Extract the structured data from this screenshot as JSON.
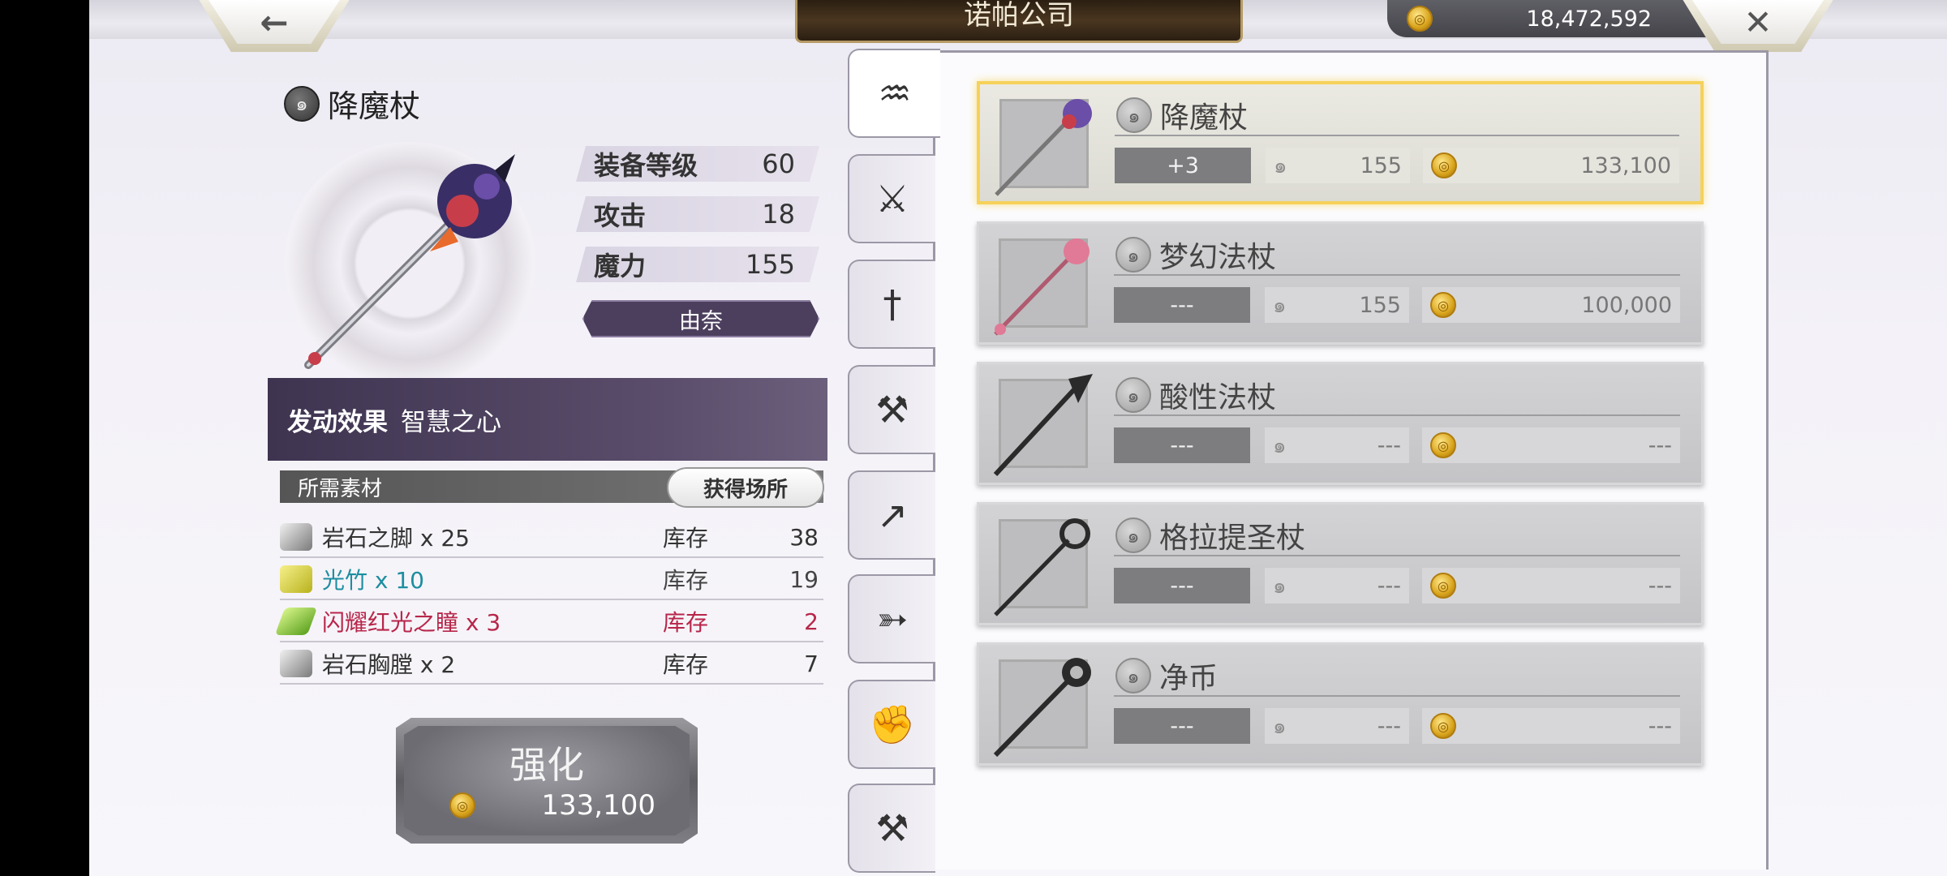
{
  "header": {
    "shop_title": "诺帕公司",
    "gold_amount": "18,472,592",
    "back_icon": "arrow-left",
    "close_icon": "x-close"
  },
  "weapon": {
    "name": "降魔杖",
    "stats": [
      {
        "label": "装备等级",
        "value": "60"
      },
      {
        "label": "攻击",
        "value": "18"
      },
      {
        "label": "魔力",
        "value": "155"
      }
    ],
    "owner": "由奈",
    "effect_label": "发动效果",
    "effect_value": "智慧之心"
  },
  "materials": {
    "header": "所需素材",
    "acquire_button": "获得场所",
    "stock_label": "库存",
    "items": [
      {
        "name": "岩石之脚 x 25",
        "stock": "38",
        "color": "#444444"
      },
      {
        "name": "光竹 x 10",
        "stock": "19",
        "color": "#1d8ea0"
      },
      {
        "name": "闪耀红光之瞳 x 3",
        "stock": "2",
        "color": "#b8264a"
      },
      {
        "name": "岩石胸膛 x 2",
        "stock": "7",
        "color": "#444444"
      }
    ]
  },
  "enhance": {
    "label": "强化",
    "cost": "133,100"
  },
  "tabs": [
    {
      "icon": "rod-icon"
    },
    {
      "icon": "sword-icon"
    },
    {
      "icon": "katana-icon"
    },
    {
      "icon": "axe-icon"
    },
    {
      "icon": "spear-icon"
    },
    {
      "icon": "bow-icon"
    },
    {
      "icon": "fist-icon"
    },
    {
      "icon": "hammer-icon"
    }
  ],
  "list": [
    {
      "name": "降魔杖",
      "level": "+3",
      "magic": "155",
      "price": "133,100"
    },
    {
      "name": "梦幻法杖",
      "level": "---",
      "magic": "155",
      "price": "100,000"
    },
    {
      "name": "酸性法杖",
      "level": "---",
      "magic": "---",
      "price": "---"
    },
    {
      "name": "格拉提圣杖",
      "level": "---",
      "magic": "---",
      "price": "---"
    },
    {
      "name": "净币",
      "level": "---",
      "magic": "---",
      "price": "---"
    }
  ],
  "colors": {
    "selected_border": "#f6d15a",
    "effect_bg": "#3e3450",
    "owner_bg": "#4c3f5e"
  }
}
